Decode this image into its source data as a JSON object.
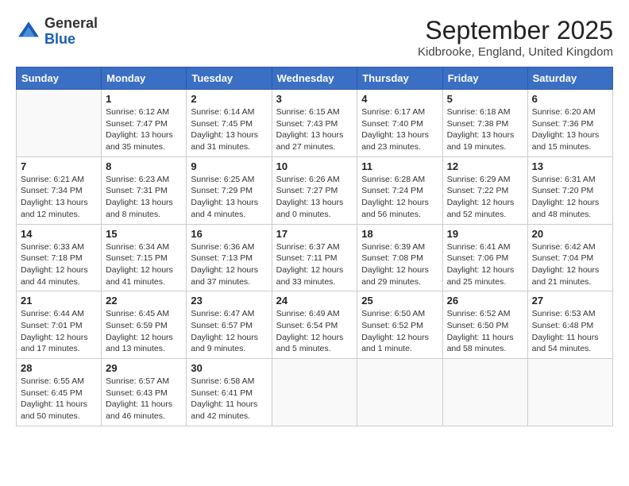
{
  "logo": {
    "general": "General",
    "blue": "Blue"
  },
  "title": "September 2025",
  "subtitle": "Kidbrooke, England, United Kingdom",
  "days_of_week": [
    "Sunday",
    "Monday",
    "Tuesday",
    "Wednesday",
    "Thursday",
    "Friday",
    "Saturday"
  ],
  "weeks": [
    [
      {
        "day": "",
        "info": ""
      },
      {
        "day": "1",
        "info": "Sunrise: 6:12 AM\nSunset: 7:47 PM\nDaylight: 13 hours\nand 35 minutes."
      },
      {
        "day": "2",
        "info": "Sunrise: 6:14 AM\nSunset: 7:45 PM\nDaylight: 13 hours\nand 31 minutes."
      },
      {
        "day": "3",
        "info": "Sunrise: 6:15 AM\nSunset: 7:43 PM\nDaylight: 13 hours\nand 27 minutes."
      },
      {
        "day": "4",
        "info": "Sunrise: 6:17 AM\nSunset: 7:40 PM\nDaylight: 13 hours\nand 23 minutes."
      },
      {
        "day": "5",
        "info": "Sunrise: 6:18 AM\nSunset: 7:38 PM\nDaylight: 13 hours\nand 19 minutes."
      },
      {
        "day": "6",
        "info": "Sunrise: 6:20 AM\nSunset: 7:36 PM\nDaylight: 13 hours\nand 15 minutes."
      }
    ],
    [
      {
        "day": "7",
        "info": "Sunrise: 6:21 AM\nSunset: 7:34 PM\nDaylight: 13 hours\nand 12 minutes."
      },
      {
        "day": "8",
        "info": "Sunrise: 6:23 AM\nSunset: 7:31 PM\nDaylight: 13 hours\nand 8 minutes."
      },
      {
        "day": "9",
        "info": "Sunrise: 6:25 AM\nSunset: 7:29 PM\nDaylight: 13 hours\nand 4 minutes."
      },
      {
        "day": "10",
        "info": "Sunrise: 6:26 AM\nSunset: 7:27 PM\nDaylight: 13 hours\nand 0 minutes."
      },
      {
        "day": "11",
        "info": "Sunrise: 6:28 AM\nSunset: 7:24 PM\nDaylight: 12 hours\nand 56 minutes."
      },
      {
        "day": "12",
        "info": "Sunrise: 6:29 AM\nSunset: 7:22 PM\nDaylight: 12 hours\nand 52 minutes."
      },
      {
        "day": "13",
        "info": "Sunrise: 6:31 AM\nSunset: 7:20 PM\nDaylight: 12 hours\nand 48 minutes."
      }
    ],
    [
      {
        "day": "14",
        "info": "Sunrise: 6:33 AM\nSunset: 7:18 PM\nDaylight: 12 hours\nand 44 minutes."
      },
      {
        "day": "15",
        "info": "Sunrise: 6:34 AM\nSunset: 7:15 PM\nDaylight: 12 hours\nand 41 minutes."
      },
      {
        "day": "16",
        "info": "Sunrise: 6:36 AM\nSunset: 7:13 PM\nDaylight: 12 hours\nand 37 minutes."
      },
      {
        "day": "17",
        "info": "Sunrise: 6:37 AM\nSunset: 7:11 PM\nDaylight: 12 hours\nand 33 minutes."
      },
      {
        "day": "18",
        "info": "Sunrise: 6:39 AM\nSunset: 7:08 PM\nDaylight: 12 hours\nand 29 minutes."
      },
      {
        "day": "19",
        "info": "Sunrise: 6:41 AM\nSunset: 7:06 PM\nDaylight: 12 hours\nand 25 minutes."
      },
      {
        "day": "20",
        "info": "Sunrise: 6:42 AM\nSunset: 7:04 PM\nDaylight: 12 hours\nand 21 minutes."
      }
    ],
    [
      {
        "day": "21",
        "info": "Sunrise: 6:44 AM\nSunset: 7:01 PM\nDaylight: 12 hours\nand 17 minutes."
      },
      {
        "day": "22",
        "info": "Sunrise: 6:45 AM\nSunset: 6:59 PM\nDaylight: 12 hours\nand 13 minutes."
      },
      {
        "day": "23",
        "info": "Sunrise: 6:47 AM\nSunset: 6:57 PM\nDaylight: 12 hours\nand 9 minutes."
      },
      {
        "day": "24",
        "info": "Sunrise: 6:49 AM\nSunset: 6:54 PM\nDaylight: 12 hours\nand 5 minutes."
      },
      {
        "day": "25",
        "info": "Sunrise: 6:50 AM\nSunset: 6:52 PM\nDaylight: 12 hours\nand 1 minute."
      },
      {
        "day": "26",
        "info": "Sunrise: 6:52 AM\nSunset: 6:50 PM\nDaylight: 11 hours\nand 58 minutes."
      },
      {
        "day": "27",
        "info": "Sunrise: 6:53 AM\nSunset: 6:48 PM\nDaylight: 11 hours\nand 54 minutes."
      }
    ],
    [
      {
        "day": "28",
        "info": "Sunrise: 6:55 AM\nSunset: 6:45 PM\nDaylight: 11 hours\nand 50 minutes."
      },
      {
        "day": "29",
        "info": "Sunrise: 6:57 AM\nSunset: 6:43 PM\nDaylight: 11 hours\nand 46 minutes."
      },
      {
        "day": "30",
        "info": "Sunrise: 6:58 AM\nSunset: 6:41 PM\nDaylight: 11 hours\nand 42 minutes."
      },
      {
        "day": "",
        "info": ""
      },
      {
        "day": "",
        "info": ""
      },
      {
        "day": "",
        "info": ""
      },
      {
        "day": "",
        "info": ""
      }
    ]
  ]
}
